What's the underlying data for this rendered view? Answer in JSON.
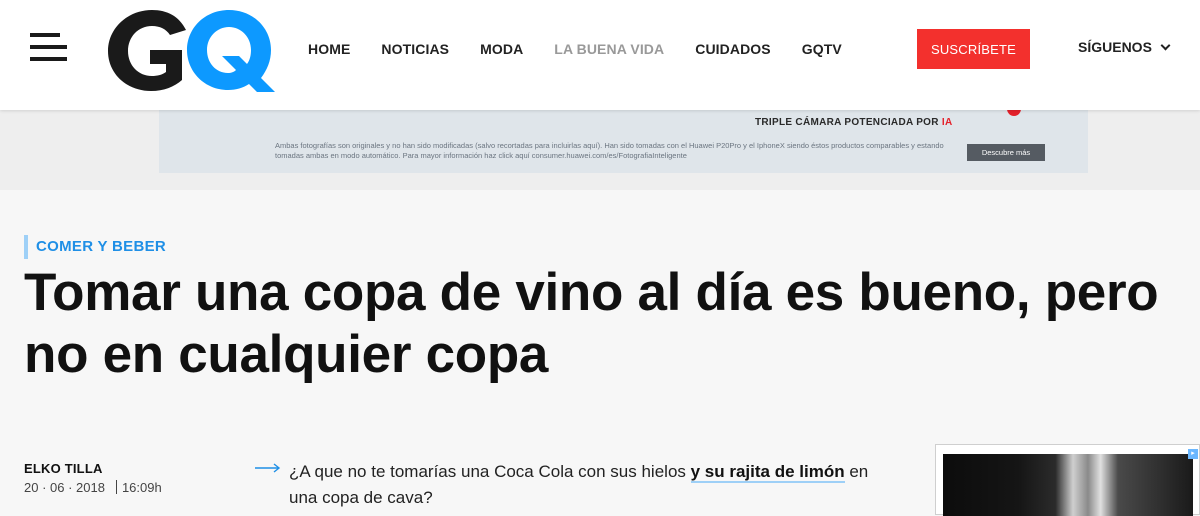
{
  "header": {
    "logo_text": "GQ",
    "nav": [
      {
        "label": "HOME",
        "active": false
      },
      {
        "label": "NOTICIAS",
        "active": false
      },
      {
        "label": "MODA",
        "active": false
      },
      {
        "label": "LA BUENA VIDA",
        "active": true
      },
      {
        "label": "CUIDADOS",
        "active": false
      },
      {
        "label": "GQTV",
        "active": false
      }
    ],
    "subscribe_label": "SUSCRÍBETE",
    "follow_label": "SÍGUENOS"
  },
  "ad": {
    "tagline": "TRIPLE CÁMARA POTENCIADA POR",
    "tagline_highlight": "IA",
    "disclaimer": "Ambas fotografías son originales y no han sido modificadas (salvo recortadas para incluirlas aquí). Han sido tomadas con el Huawei P20Pro y el IphoneX siendo éstos productos comparables y estando tomadas ambas en modo automático. Para mayor información haz click aquí consumer.huawei.com/es/FotografiaInteligente",
    "button_label": "Descubre más"
  },
  "article": {
    "category": "COMER Y BEBER",
    "headline": "Tomar una copa de vino al día es bueno, pero no en cualquier copa",
    "author": "ELKO TILLA",
    "date": "20 · 06 · 2018",
    "time": "16:09h",
    "lead_before": "¿A que no te tomarías una Coca Cola con sus hielos ",
    "lead_link": "y su rajita de limón",
    "lead_after": " en una copa de cava?"
  },
  "colors": {
    "accent_blue": "#1f8fe6",
    "subscribe_red": "#f3302d",
    "logo_blue": "#0d99ff",
    "logo_black": "#1a1a1a"
  },
  "icons": {
    "menu": "hamburger-icon",
    "follow_dropdown": "chevron-down-icon",
    "lead": "arrow-right-icon"
  }
}
